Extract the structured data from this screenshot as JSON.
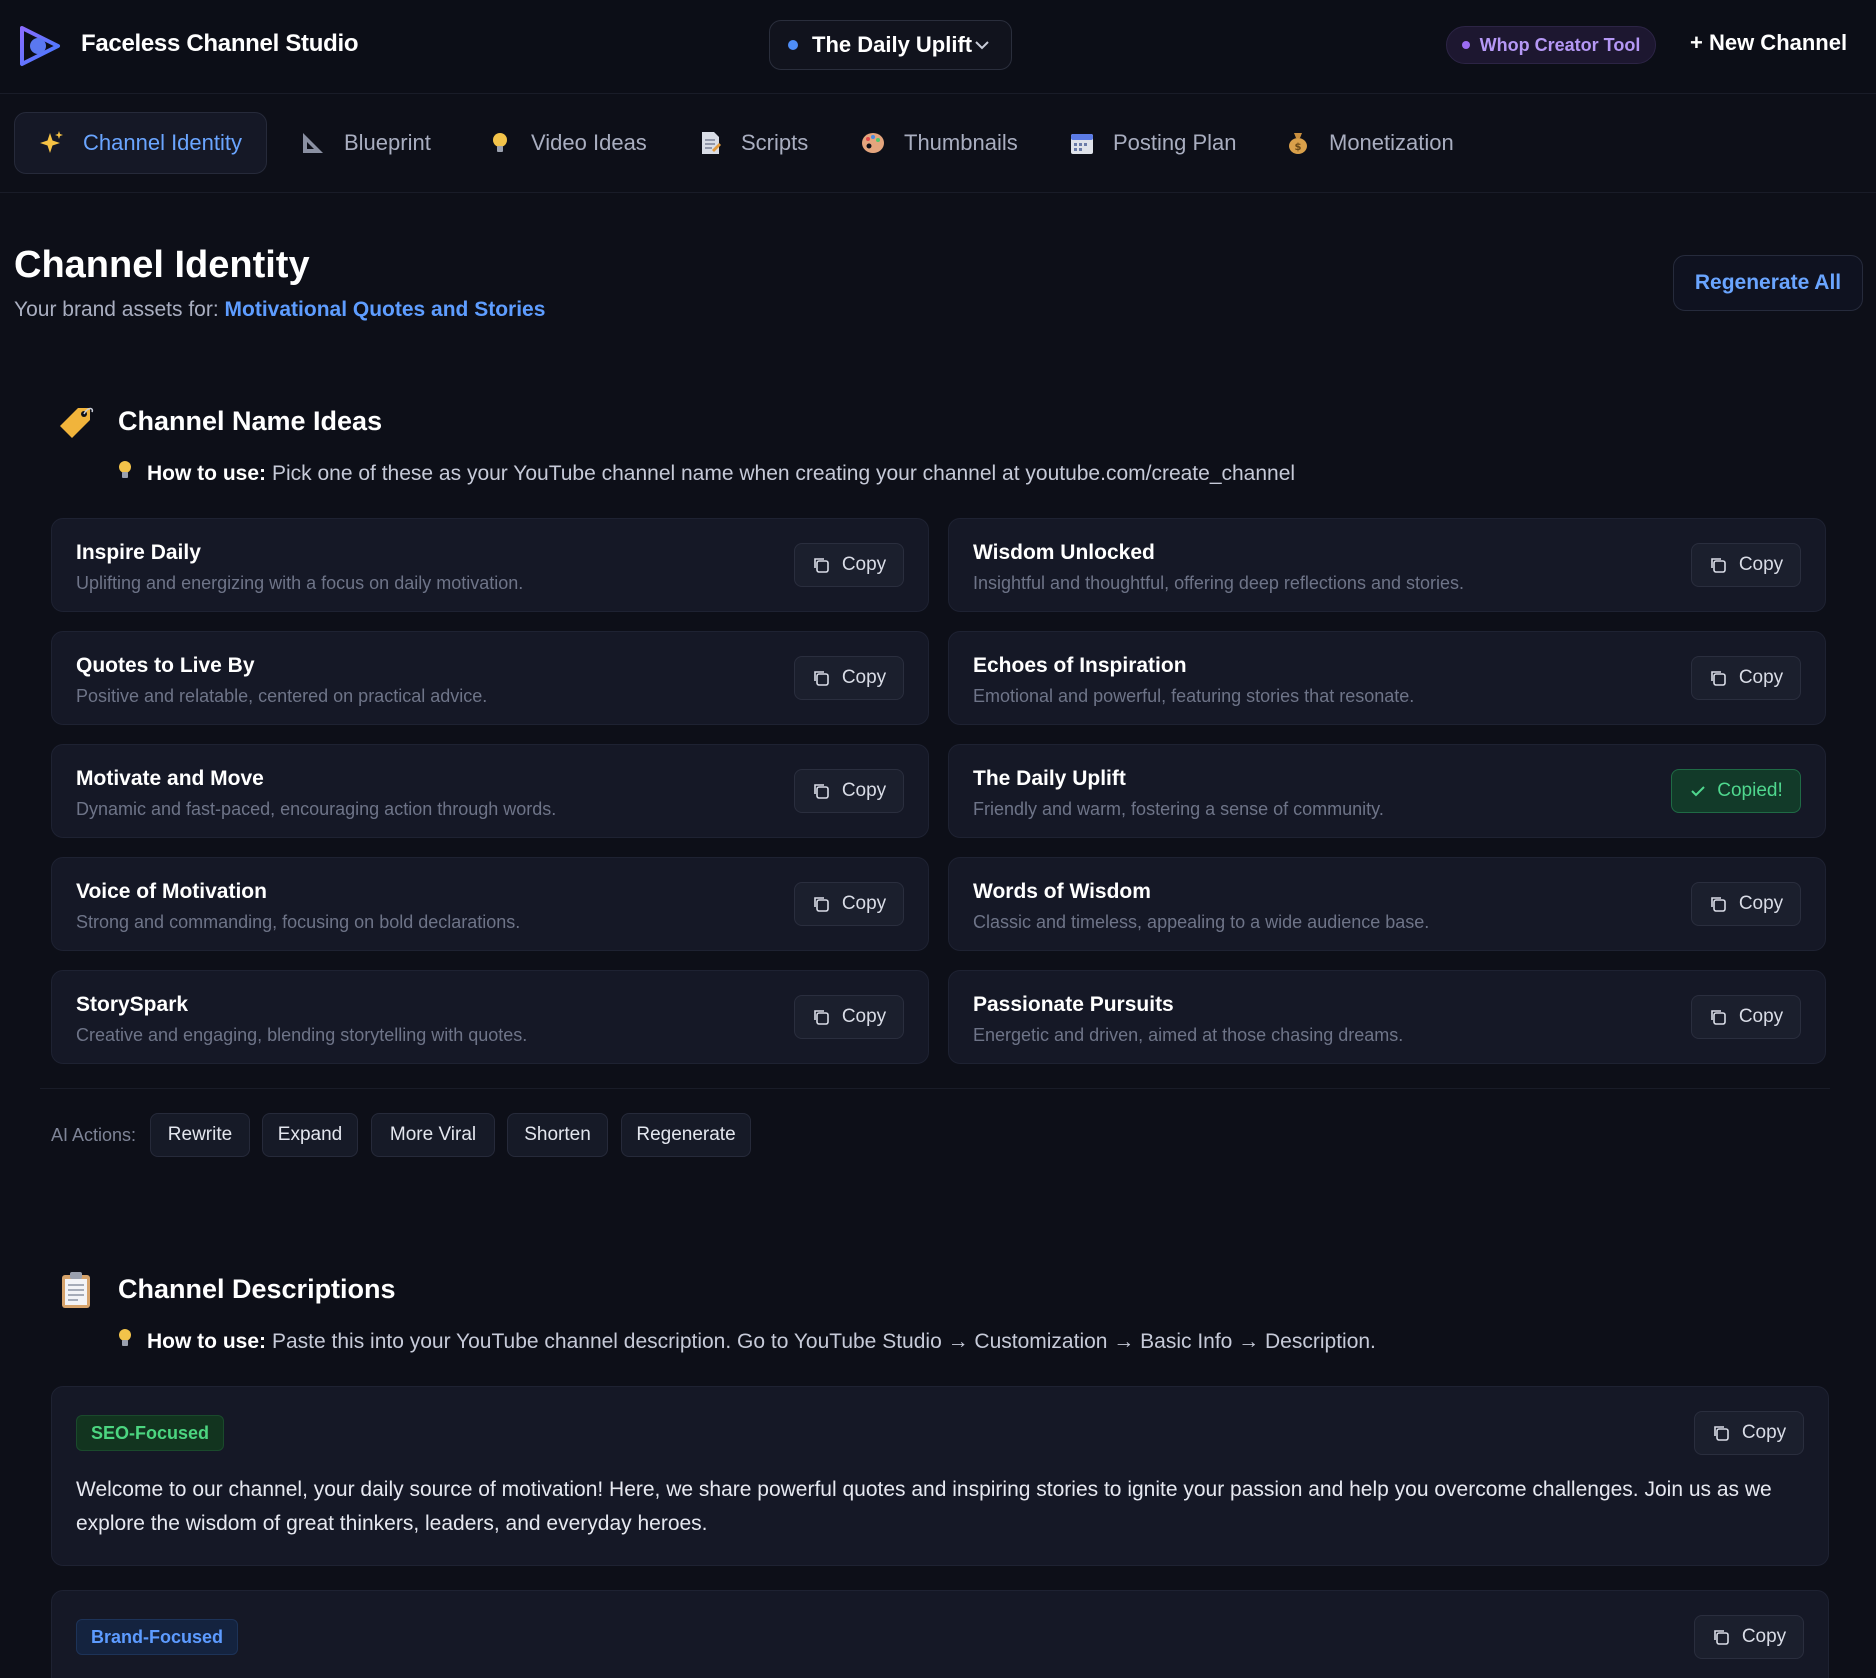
{
  "app": {
    "title": "Faceless Channel Studio",
    "current_channel": "The Daily Uplift",
    "badge": "Whop Creator Tool",
    "new_channel": "+ New Channel"
  },
  "tabs": [
    {
      "label": "Channel Identity",
      "icon": "sparkles-icon",
      "active": true
    },
    {
      "label": "Blueprint",
      "icon": "triangle-ruler-icon"
    },
    {
      "label": "Video Ideas",
      "icon": "lightbulb-icon"
    },
    {
      "label": "Scripts",
      "icon": "page-icon"
    },
    {
      "label": "Thumbnails",
      "icon": "palette-icon"
    },
    {
      "label": "Posting Plan",
      "icon": "calendar-icon"
    },
    {
      "label": "Monetization",
      "icon": "money-bag-icon"
    }
  ],
  "page": {
    "title": "Channel Identity",
    "subtitle_prefix": "Your brand assets for:",
    "subtitle_topic": "Motivational Quotes and Stories",
    "regenerate_all": "Regenerate All"
  },
  "name_ideas": {
    "title": "Channel Name Ideas",
    "howto_label": "How to use:",
    "howto_text": "Pick one of these as your YouTube channel name when creating your channel at youtube.com/create_channel",
    "copy_label": "Copy",
    "copied_label": "Copied!",
    "items": [
      {
        "name": "Inspire Daily",
        "desc": "Uplifting and energizing with a focus on daily motivation."
      },
      {
        "name": "Wisdom Unlocked",
        "desc": "Insightful and thoughtful, offering deep reflections and stories."
      },
      {
        "name": "Quotes to Live By",
        "desc": "Positive and relatable, centered on practical advice."
      },
      {
        "name": "Echoes of Inspiration",
        "desc": "Emotional and powerful, featuring stories that resonate."
      },
      {
        "name": "Motivate and Move",
        "desc": "Dynamic and fast-paced, encouraging action through words."
      },
      {
        "name": "The Daily Uplift",
        "desc": "Friendly and warm, fostering a sense of community.",
        "copied": true
      },
      {
        "name": "Voice of Motivation",
        "desc": "Strong and commanding, focusing on bold declarations."
      },
      {
        "name": "Words of Wisdom",
        "desc": "Classic and timeless, appealing to a wide audience base."
      },
      {
        "name": "StorySpark",
        "desc": "Creative and engaging, blending storytelling with quotes."
      },
      {
        "name": "Passionate Pursuits",
        "desc": "Energetic and driven, aimed at those chasing dreams."
      }
    ]
  },
  "ai_actions": {
    "label": "AI Actions:",
    "buttons": [
      "Rewrite",
      "Expand",
      "More Viral",
      "Shorten",
      "Regenerate"
    ]
  },
  "descriptions": {
    "title": "Channel Descriptions",
    "howto_label": "How to use:",
    "howto_text": "Paste this into your YouTube channel description. Go to YouTube Studio → Customization → Basic Info → Description.",
    "copy_label": "Copy",
    "items": [
      {
        "tag": "SEO-Focused",
        "text": "Welcome to our channel, your daily source of motivation! Here, we share powerful quotes and inspiring stories to ignite your passion and help you overcome challenges. Join us as we explore the wisdom of great thinkers, leaders, and everyday heroes."
      },
      {
        "tag": "Brand-Focused",
        "text": ""
      }
    ]
  },
  "colors": {
    "background": "#0d0f18",
    "card": "#151826",
    "accent": "#5e9dff",
    "success": "#4fd78e",
    "purple": "#b598f5"
  }
}
